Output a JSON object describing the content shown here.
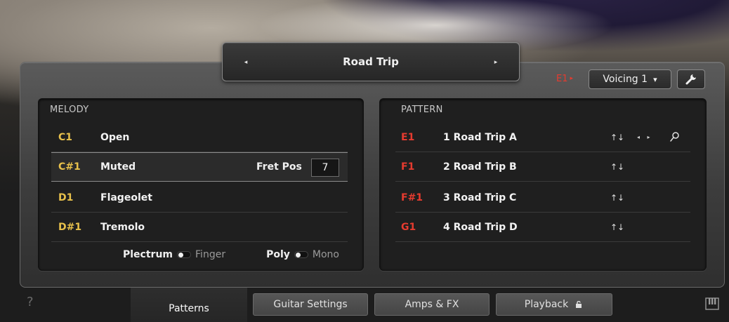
{
  "header": {
    "preset_name": "Road Trip",
    "prev_arrow": "◂",
    "next_arrow": "▸"
  },
  "top_right": {
    "key_label": "E1",
    "key_marker": "▸",
    "voicing_value": "Voicing 1",
    "voicing_arrow": "▾",
    "settings_icon": "wrench-icon"
  },
  "melody": {
    "title": "MELODY",
    "rows": [
      {
        "note": "C1",
        "name": "Open"
      },
      {
        "note": "C#1",
        "name": "Muted"
      },
      {
        "note": "D1",
        "name": "Flageolet"
      },
      {
        "note": "D#1",
        "name": "Tremolo"
      }
    ],
    "fret_label": "Fret Pos",
    "fret_value": "7",
    "toggle1_on": "Plectrum",
    "toggle1_off": "Finger",
    "toggle2_on": "Poly",
    "toggle2_off": "Mono"
  },
  "pattern": {
    "title": "PATTERN",
    "rows": [
      {
        "note": "E1",
        "name": "1  Road Trip A",
        "sort": "↑↓"
      },
      {
        "note": "F1",
        "name": "2  Road Trip B",
        "sort": "↑↓"
      },
      {
        "note": "F#1",
        "name": "3  Road Trip C",
        "sort": "↑↓"
      },
      {
        "note": "G1",
        "name": "4  Road Trip D",
        "sort": "↑↓"
      }
    ],
    "nav_arrows": "◂ ▸"
  },
  "tabs": {
    "help": "?",
    "items": [
      "Patterns",
      "Guitar Settings",
      "Amps & FX",
      "Playback"
    ]
  },
  "colors": {
    "melody_note": "#e7c04b",
    "pattern_note": "#e53b2f"
  }
}
